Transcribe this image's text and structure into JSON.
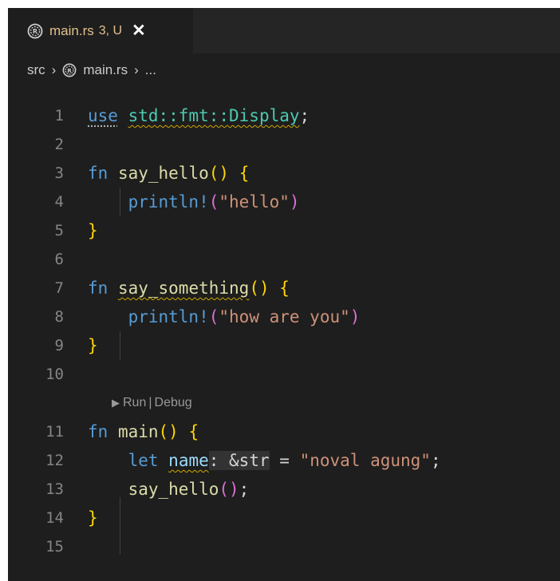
{
  "tab": {
    "filename": "main.rs",
    "badge": "3, U",
    "close_icon": "close-icon"
  },
  "breadcrumb": {
    "folder": "src",
    "file": "main.rs",
    "more": "..."
  },
  "codelens": {
    "run": "Run",
    "separator": "|",
    "debug": "Debug"
  },
  "line_numbers": [
    "1",
    "2",
    "3",
    "4",
    "5",
    "6",
    "7",
    "8",
    "9",
    "10",
    "11",
    "12",
    "13",
    "14",
    "15"
  ],
  "code": {
    "l1_use": "use",
    "l1_path": "std::fmt::Display",
    "l1_end": ";",
    "l3_fn": "fn",
    "l3_name": "say_hello",
    "l3_parens": "()",
    "l3_brace": "{",
    "l4_macro": "println!",
    "l4_open": "(",
    "l4_str": "\"hello\"",
    "l4_close": ")",
    "l5_brace": "}",
    "l7_fn": "fn",
    "l7_name": "say_something",
    "l7_parens": "()",
    "l7_brace": "{",
    "l8_macro": "println!",
    "l8_open": "(",
    "l8_str": "\"how are you\"",
    "l8_close": ")",
    "l9_brace": "}",
    "l11_fn": "fn",
    "l11_name": "main",
    "l11_parens": "()",
    "l11_brace": "{",
    "l12_let": "let",
    "l12_var": "name",
    "l12_hint": ": &str",
    "l12_eq": "=",
    "l12_str": "\"noval agung\"",
    "l12_end": ";",
    "l13_call": "say_hello",
    "l13_parens": "()",
    "l13_end": ";",
    "l14_brace": "}"
  },
  "colors": {
    "background": "#1e1e1e",
    "keyword": "#569cd6",
    "function": "#dcdcaa",
    "type_path": "#4ec9b0",
    "string": "#ce9178",
    "bracket_gold": "#ffd700",
    "bracket_purple": "#da70d6",
    "modified_tab": "#e2c08d"
  }
}
